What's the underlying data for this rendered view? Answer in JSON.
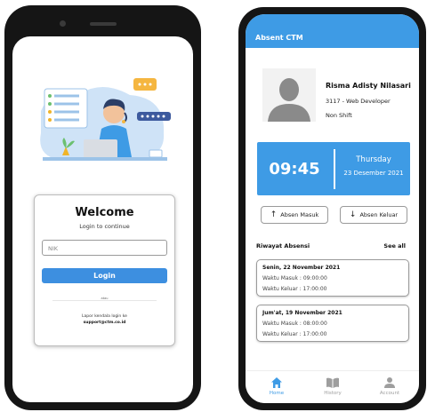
{
  "login": {
    "welcome": "Welcome",
    "subtitle": "Login to continue",
    "nik_placeholder": "NIK",
    "login_button": "Login",
    "or": "atau",
    "trouble_text": "Lapor kendala login ke",
    "support_email": "support@ctm.co.id"
  },
  "dashboard": {
    "app_title": "Absent CTM",
    "profile": {
      "name": "Risma Adisty Nilasari",
      "role": "3117 - Web Developer",
      "shift": "Non Shift"
    },
    "clock": {
      "time": "09:45",
      "day": "Thursday",
      "date": "23 Desember 2021"
    },
    "buttons": {
      "absen_masuk": "Absen Masuk",
      "absen_keluar": "Absen Keluar"
    },
    "history": {
      "title": "Riwayat Absensi",
      "see_all": "See all",
      "items": [
        {
          "date": "Senin, 22 November 2021",
          "in": "Waktu Masuk : 09:00:00",
          "out": "Waktu Keluar : 17:00:00"
        },
        {
          "date": "Jum'at, 19 November 2021",
          "in": "Waktu Masuk : 08:00:00",
          "out": "Waktu Keluar : 17:00:00"
        }
      ]
    },
    "nav": {
      "home": "Home",
      "history": "History",
      "account": "Account"
    }
  },
  "colors": {
    "accent": "#3e9be5",
    "phone": "#151515",
    "active_nav": "#3e9be5",
    "inactive_nav": "#9e9e9e"
  },
  "icons": [
    "home-icon",
    "book-icon",
    "user-icon",
    "arrow-up-icon",
    "arrow-down-icon"
  ]
}
